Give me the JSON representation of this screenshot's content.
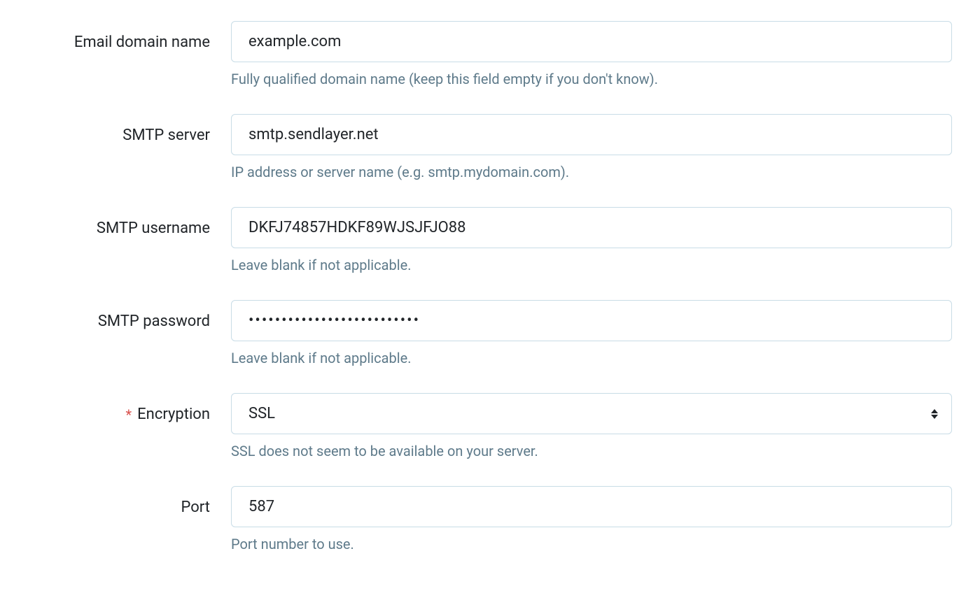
{
  "fields": {
    "domain": {
      "label": "Email domain name",
      "value": "example.com",
      "help": "Fully qualified domain name (keep this field empty if you don't know)."
    },
    "smtp_server": {
      "label": "SMTP server",
      "value": "smtp.sendlayer.net",
      "help": "IP address or server name (e.g. smtp.mydomain.com)."
    },
    "smtp_username": {
      "label": "SMTP username",
      "value": "DKFJ74857HDKF89WJSJFJO88",
      "help": "Leave blank if not applicable."
    },
    "smtp_password": {
      "label": "SMTP password",
      "value": "••••••••••••••••••••••••••",
      "help": "Leave blank if not applicable."
    },
    "encryption": {
      "label": "Encryption",
      "required": "*",
      "value": "SSL",
      "help": "SSL does not seem to be available on your server."
    },
    "port": {
      "label": "Port",
      "value": "587",
      "help": "Port number to use."
    }
  }
}
